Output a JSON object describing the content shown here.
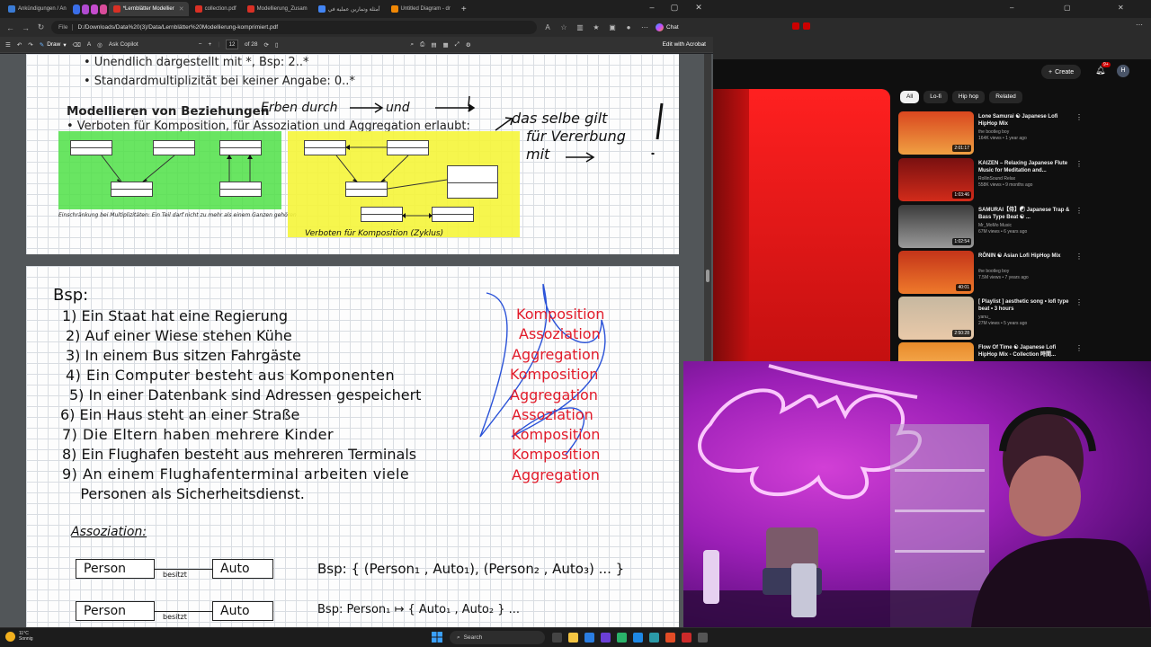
{
  "browser": {
    "tabs": [
      {
        "label": "Ankündigungen / An",
        "fav_color": "#3a7bd5",
        "active": false
      },
      {
        "label": "*Lernblätter Modellier",
        "fav_color": "#d93025",
        "active": true
      },
      {
        "label": "collection.pdf",
        "fav_color": "#d93025",
        "active": false
      },
      {
        "label": "Modellierung_Zusam",
        "fav_color": "#d93025",
        "active": false
      },
      {
        "label": "أمثلة وتمارين عملية في",
        "fav_color": "#4285f4",
        "active": false
      },
      {
        "label": "Untitled Diagram - dr",
        "fav_color": "#f08705",
        "active": false
      }
    ],
    "tab_chips": [
      {
        "label": "",
        "color": "#3a6ee8"
      },
      {
        "label": "",
        "color": "#b04ad0"
      },
      {
        "label": "",
        "color": "#c44ccd"
      },
      {
        "label": "",
        "color": "#d94c9a"
      }
    ],
    "new_tab": "+",
    "address": {
      "file_label": "File",
      "url": "D:/Downloads/Data%20(3)/Data/Lernblätter%20Modellierung-komprimiert.pdf"
    },
    "chat_label": "Chat",
    "pdf_toolbar": {
      "draw_label": "Draw",
      "copilot_label": "Ask Copilot",
      "minus": "−",
      "plus": "+",
      "page_current": "12",
      "page_total": "of 28",
      "edit_label": "Edit with Acrobat"
    }
  },
  "page1": {
    "bullet1": "•  Unendlich dargestellt mit *, Bsp: 2..*",
    "bullet2": "•  Standardmultiplizität bei keiner Angabe: 0..*",
    "heading": "Modellieren von Beziehungen",
    "heading_note": "Erben durch",
    "heading_note2": "und",
    "bullet3": "•  Verboten für Komposition, für Assoziation und  Aggregation erlaubt:",
    "side_note": [
      "das selbe gilt",
      "für Vererbung",
      "mit"
    ],
    "green_caption": "Einschränkung bei Multiplizitäten: Ein Teil darf nicht zu mehr als einem Ganzen gehören",
    "yellow_caption": "Verboten für Komposition (Zyklus)",
    "highlight_green": "#4fe047",
    "highlight_yellow": "#f5f53a"
  },
  "page2": {
    "bsp_label": "Bsp:",
    "examples": [
      "1) Ein Staat hat eine Regierung",
      "2) Auf einer Wiese stehen Kühe",
      "3) In einem Bus sitzen Fahrgäste",
      "4) Ein Computer besteht aus Komponenten",
      "5) In einer Datenbank sind Adressen gespeichert",
      "6) Ein Haus steht an einer Straße",
      "7) Die Eltern haben mehrere Kinder",
      "8) Ein Flughafen besteht aus mehreren Terminals",
      "9) An einem Flughafenterminal arbeiten viele",
      "    Personen als Sicherheitsdienst."
    ],
    "answers": [
      "Komposition",
      "Assoziation",
      "Aggregation",
      "Komposition",
      "Aggregation",
      "Assoziation",
      "Komposition",
      "Komposition",
      "Aggregation"
    ],
    "assoc_heading": "Assoziation:",
    "row1": {
      "left": "Person",
      "link": "besitzt",
      "right": "Auto",
      "bsp": "Bsp:  { (Person₁ , Auto₁), (Person₂ , Auto₃) ... }"
    },
    "row2": {
      "left": "Person",
      "link": "besitzt",
      "right": "Auto",
      "bsp": "Bsp:  Person₁ ↦ { Auto₁ , Auto₂ } ..."
    }
  },
  "youtube": {
    "create_label": "Create",
    "notif_count": "9+",
    "avatar_letter": "H",
    "chips": [
      "All",
      "Lo-fi",
      "Hip hop",
      "Related"
    ],
    "recs": [
      {
        "title": "Lone Samurai ☯ Japanese Lofi HipHop Mix",
        "channel": "the bootleg boy",
        "meta": "164K views • 1 year ago",
        "duration": "2:01:17",
        "c1": "#d9471f",
        "c2": "#f0a042"
      },
      {
        "title": "KAIZEN – Relaxing Japanese Flute Music for Meditation and...",
        "channel": "RollinSound Relax",
        "meta": "558K views • 9 months ago",
        "duration": "1:03:46",
        "c1": "#7a1010",
        "c2": "#d22b1a"
      },
      {
        "title": "SAMURAI【侍】☯ Japanese Trap & Bass Type Beat ☯ ...",
        "channel": "Mr_MoMo Music",
        "meta": "67M views • 6 years ago",
        "duration": "1:02:54",
        "c1": "#3b3b3b",
        "c2": "#9a9a9a"
      },
      {
        "title": "RŌNIN ☯ Asian Lofi HipHop Mix",
        "channel": "the bootleg boy",
        "meta": "7.5M views • 7 years ago",
        "duration": "40:01",
        "c1": "#c43419",
        "c2": "#ef7a2b"
      },
      {
        "title": "[ Playlist ] aesthetic song • lofi type beat • 3 hours",
        "channel": "yanu_",
        "meta": "27M views • 5 years ago",
        "duration": "2:50:28",
        "c1": "#c7b8a0",
        "c2": "#e9c9a9"
      },
      {
        "title": "Flow Of Time ☯ Japanese Lofi HipHop Mix - Collection 時間...",
        "channel": "",
        "meta": "",
        "duration": "",
        "c1": "#e88a2a",
        "c2": "#ffc26a"
      }
    ]
  },
  "taskbar": {
    "temp": "11°C",
    "weather": "Sonnig",
    "search_label": "Search"
  }
}
